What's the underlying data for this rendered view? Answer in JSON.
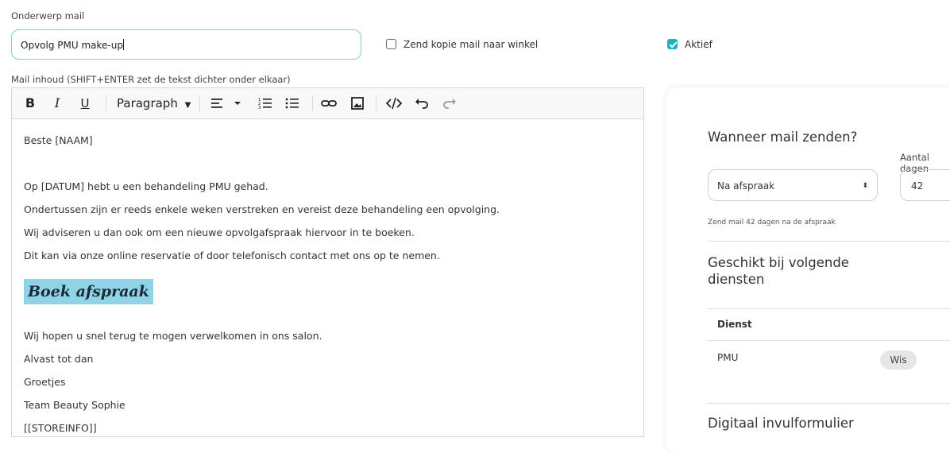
{
  "subject": {
    "label": "Onderwerp mail",
    "value": "Opvolg PMU make-up"
  },
  "copy_checkbox": {
    "label": "Zend kopie mail naar winkel",
    "checked": false
  },
  "active_checkbox": {
    "label": "Aktief",
    "checked": true,
    "color": "#1cb3be"
  },
  "editor": {
    "label": "Mail inhoud  (SHIFT+ENTER zet de tekst dichter onder elkaar)",
    "toolbar": {
      "bold": "B",
      "italic": "I",
      "underline": "U",
      "block_format": "Paragraph",
      "icons": [
        "bold-icon",
        "italic-icon",
        "underline-icon",
        "align-left-icon",
        "ordered-list-icon",
        "bullet-list-icon",
        "link-icon",
        "image-icon",
        "code-icon",
        "undo-icon",
        "redo-icon"
      ]
    },
    "lines": [
      "Beste [NAAM]",
      "Op [DATUM] hebt u een behandeling PMU gehad.",
      "Ondertussen zijn er reeds enkele weken verstreken en vereist deze behandeling een opvolging.",
      "Wij adviseren u dan ook om een nieuwe opvolgafspraak hiervoor in te boeken.",
      "Dit kan via onze online reservatie of door telefonisch contact met ons op te nemen.",
      "Wij hopen u snel terug te mogen verwelkomen in ons salon.",
      "Alvast tot dan",
      "Groetjes",
      "Team Beauty Sophie",
      "[[STOREINFO]]"
    ],
    "cta_button": {
      "label": "Boek afspraak",
      "background": "#8fd3e6"
    }
  },
  "schedule": {
    "title": "Wanneer mail zenden?",
    "when_select": "Na afspraak",
    "days_label": "Aantal dagen",
    "days_value": "42",
    "hint": "Zend mail 42 dagen na de afspraak"
  },
  "services": {
    "title": "Geschikt bij volgende diensten",
    "column_header": "Dienst",
    "rows": [
      {
        "name": "PMU",
        "action": "Wis"
      }
    ]
  },
  "form_section": {
    "title": "Digitaal invulformulier"
  }
}
